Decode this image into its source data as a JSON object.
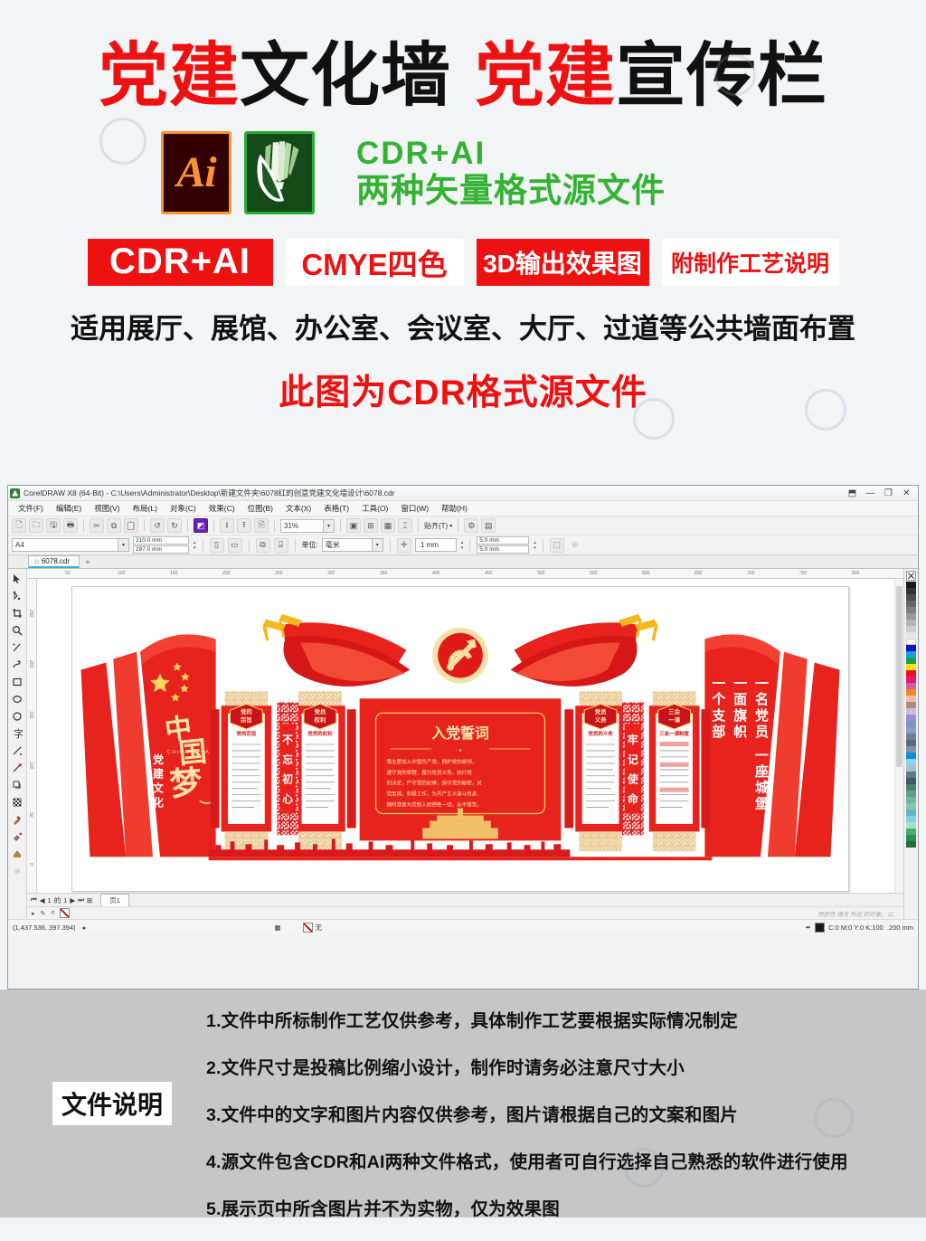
{
  "promo": {
    "title_parts": [
      {
        "text": "党建",
        "color": "red"
      },
      {
        "text": "文化墙",
        "color": "black"
      },
      {
        "text": "党建",
        "color": "red"
      },
      {
        "text": "宣传栏",
        "color": "black"
      }
    ],
    "ai_logo_label": "Ai",
    "cdr_logo_label": "CorelDRAW",
    "format_line1": "CDR+AI",
    "format_line2": "两种矢量格式源文件",
    "format_color": "#33b233",
    "badges": [
      {
        "label": "CDR+AI",
        "style": "filled"
      },
      {
        "label": "CMYE四色",
        "style": "outline"
      },
      {
        "label": "3D输出效果图",
        "style": "filled"
      },
      {
        "label": "附制作工艺说明",
        "style": "outline"
      }
    ],
    "subtitle": "适用展厅、展馆、办公室、会议室、大厅、过道等公共墙面布置",
    "note": "此图为CDR格式源文件",
    "accent_red": "#ee1111"
  },
  "coreldraw": {
    "title": "CorelDRAW X8 (64-Bit) - C:\\Users\\Administrator\\Desktop\\新建文件夹\\6078红的创意党建文化墙设计\\6078.cdr",
    "window_buttons": [
      "restore-up",
      "minimize",
      "restore",
      "close"
    ],
    "menus": [
      "文件(F)",
      "编辑(E)",
      "视图(V)",
      "布局(L)",
      "对象(C)",
      "效果(C)",
      "位图(B)",
      "文本(X)",
      "表格(T)",
      "工具(O)",
      "窗口(W)",
      "帮助(H)"
    ],
    "toolbar": {
      "zoom_level": "31%",
      "snap_label": "贴齐(T)",
      "page_preset": "A4",
      "page_width": "210.0 mm",
      "page_height": "297.0 mm",
      "units_label": "单位:",
      "units_value": "毫米",
      "nudge": ".1 mm",
      "duplicate_x": "5.0 mm",
      "duplicate_y": "5.0 mm"
    },
    "document_tab": "6078.cdr",
    "document_tab_add": "+",
    "page_nav": {
      "current": "1",
      "of_label": "的",
      "total": "1",
      "page_tab": "页1"
    },
    "status": {
      "hint": "用颜色 填充 所选 的对象，以…",
      "fill_label": "无",
      "outline_color": "C:0 M:0 Y:0 K:100",
      "outline_width": ".200 mm",
      "coordinates": "(1,437.536, 397.394)"
    },
    "tools": [
      "pick-tool",
      "shape-tool",
      "crop-tool",
      "zoom-tool",
      "freehand-tool",
      "artistic-media-tool",
      "rectangle-tool",
      "ellipse-tool",
      "polygon-tool",
      "text-tool",
      "dimension-tool",
      "connector-tool",
      "drop-shadow-tool",
      "transparency-tool",
      "color-eyedropper-tool",
      "interactive-fill-tool",
      "smart-fill-tool",
      "outline-tool"
    ],
    "palette_colors": [
      "#1a1a1a",
      "#333333",
      "#4d4d4d",
      "#666666",
      "#808080",
      "#999999",
      "#b3b3b3",
      "#cccccc",
      "#e6e6e6",
      "#ffffff",
      "#1010c0",
      "#1a9ddb",
      "#16a34a",
      "#f5e11a",
      "#ee1111",
      "#e8157a",
      "#cf5fa0",
      "#f08b18",
      "#f5b8b8",
      "#a98a7d",
      "#c9bede",
      "#9b8ec9",
      "#7e94c9",
      "#8d9bbd",
      "#6d7f9b",
      "#5b6b80",
      "#7d93a3",
      "#0e8fd4",
      "#8fd0ea",
      "#a7bfc6",
      "#5b7a86",
      "#3f5a63",
      "#4e7f72",
      "#5fa08c",
      "#77b3a0",
      "#8fc2ad",
      "#62b7c9",
      "#7fd0de",
      "#a9ddcd",
      "#3fae72",
      "#2f8d55",
      "#1f6b3d"
    ]
  },
  "artwork": {
    "emblem": "party-emblem-hammer-sickle",
    "left_panel": {
      "stars_count": 5,
      "calligraphy": "中国梦",
      "romanization": "CHINA DREAM",
      "subtitle": "党建文化"
    },
    "right_panel": {
      "line1": "一名党员 一面旗帜",
      "line2": "一个支部 一座城堡",
      "col1": "一名党员",
      "col2": "一面旗帜",
      "col3": "一个支部",
      "col4": "一座城堡"
    },
    "center_board": {
      "title": "入党誓词",
      "body": "我志愿加入中国共产党，拥护党的纲领，遵守党的章程，履行党员义务，执行党的决定，严守党的纪律，保守党的秘密，对党忠诚，积极工作，为共产主义奋斗终身，随时准备为党和人民牺牲一切，永不叛党。"
    },
    "columns": [
      {
        "badge": "党的宗旨",
        "subtitle": "党的宗旨"
      },
      {
        "badge": "党员权利",
        "subtitle": "党员的权利"
      },
      {
        "badge": "党员义务",
        "subtitle": "党员的义务"
      },
      {
        "badge": "三会一课",
        "subtitle": "三会一课制度"
      }
    ],
    "vertical_slogans": [
      "不忘初心",
      "牢记使命"
    ]
  },
  "notes": {
    "label": "文件说明",
    "items": [
      "1.文件中所标制作工艺仅供参考，具体制作工艺要根据实际情况制定",
      "2.文件尺寸是投稿比例缩小设计，制作时请务必注意尺寸大小",
      "3.文件中的文字和图片内容仅供参考，图片请根据自己的文案和图片",
      "4.源文件包含CDR和AI两种文件格式，使用者可自行选择自己熟悉的软件进行使用",
      "5.展示页中所含图片并不为实物，仅为效果图"
    ]
  }
}
